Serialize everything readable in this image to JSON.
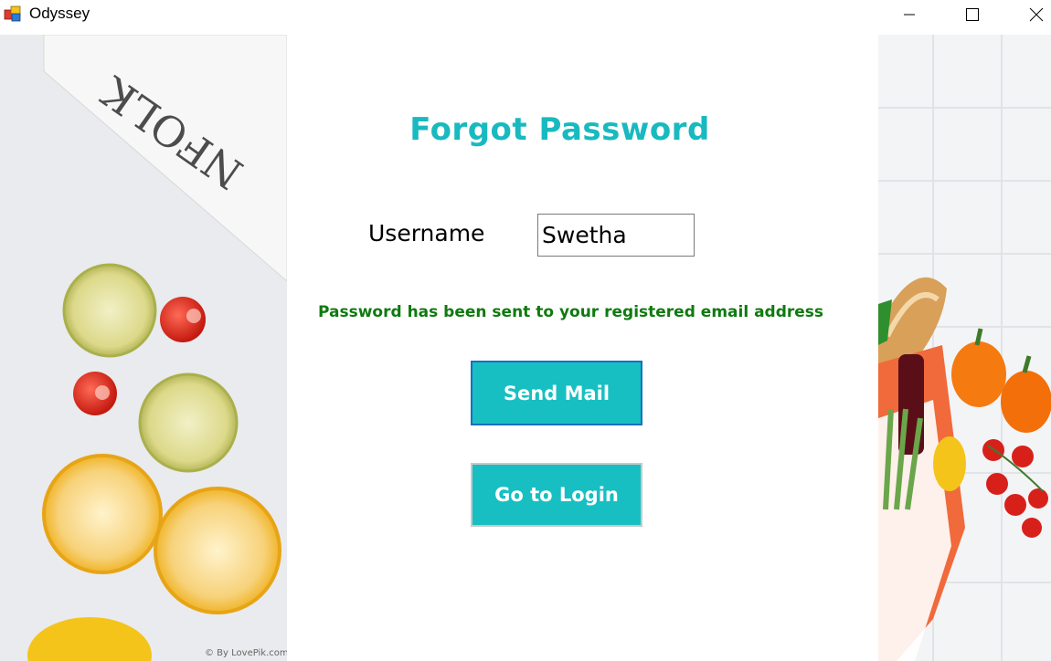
{
  "window": {
    "title": "Odyssey",
    "controls": [
      "minimize-icon",
      "maximize-icon",
      "close-icon"
    ]
  },
  "form": {
    "title": "Forgot Password",
    "username_label": "Username",
    "username_value": "Swetha",
    "status_message": "Password has been sent to your registered email address",
    "send_mail_label": "Send Mail",
    "go_to_login_label": "Go to Login"
  },
  "images": {
    "left_watermark": "© By LovePik.com",
    "left_newspaper_text": "NFOLK"
  },
  "colors": {
    "accent": "#19b9c0",
    "button": "#17bfc2",
    "status": "#0f7a0f",
    "focus_border": "#1a6fbf"
  }
}
